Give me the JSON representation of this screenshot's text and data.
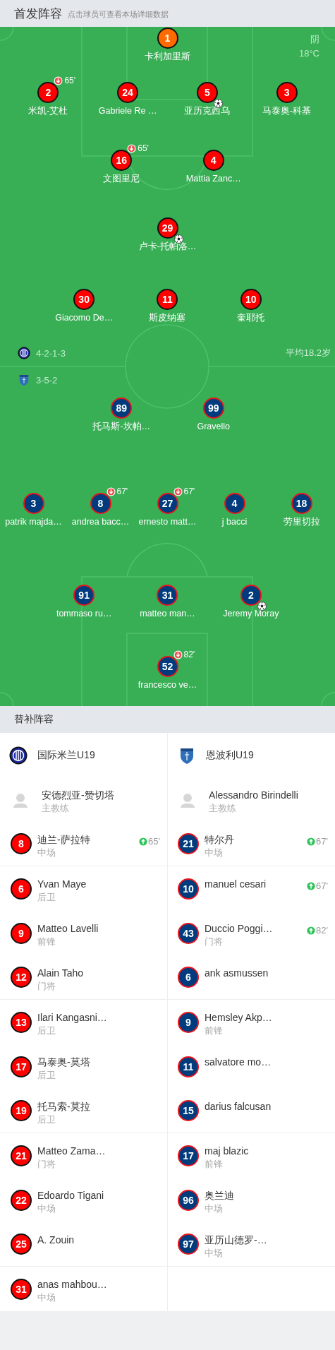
{
  "header": {
    "title": "首发阵容",
    "hint": "点击球员可查看本场详细数据"
  },
  "pitch": {
    "weather": "阴",
    "temperature": "18°C",
    "average_age": "平均18.2岁",
    "teams": [
      {
        "formation": "4-2-1-3",
        "lines": [
          {
            "players": [
              {
                "number": "1",
                "name": "卡利加里斯",
                "color": "#ff6a00",
                "goal": false
              }
            ]
          },
          {
            "players": [
              {
                "number": "2",
                "name": "米凯-艾杜",
                "color": "#ff0000",
                "goal": false,
                "sub_out": "65'"
              },
              {
                "number": "24",
                "name": "Gabriele Re …",
                "color": "#ff0000",
                "goal": false
              },
              {
                "number": "5",
                "name": "亚历克西乌",
                "color": "#ff0000",
                "goal": true
              },
              {
                "number": "3",
                "name": "马泰奥-科基",
                "color": "#ff0000",
                "goal": false
              }
            ]
          },
          {
            "players": [
              {
                "number": "16",
                "name": "文图里尼",
                "color": "#ff0000",
                "goal": false,
                "sub_out": "65'"
              },
              {
                "number": "4",
                "name": "Mattia Zanc…",
                "color": "#ff0000",
                "goal": false
              }
            ]
          },
          {
            "players": [
              {
                "number": "29",
                "name": "卢卡-托帕洛…",
                "color": "#ff0000",
                "goal": true
              }
            ]
          },
          {
            "players": [
              {
                "number": "30",
                "name": "Giacomo De…",
                "color": "#ff0000",
                "goal": false
              },
              {
                "number": "11",
                "name": "斯皮纳塞",
                "color": "#ff0000",
                "goal": false
              },
              {
                "number": "10",
                "name": "奎耶托",
                "color": "#ff0000",
                "goal": false
              }
            ]
          }
        ]
      },
      {
        "formation": "3-5-2",
        "lines": [
          {
            "players": [
              {
                "number": "89",
                "name": "托马斯-坎帕…",
                "color": "#003b7d",
                "goal": false
              },
              {
                "number": "99",
                "name": "Gravello",
                "color": "#003b7d",
                "goal": false
              }
            ]
          },
          {
            "players": [
              {
                "number": "3",
                "name": "patrik majda…",
                "color": "#003b7d",
                "goal": false
              },
              {
                "number": "8",
                "name": "andrea bacc…",
                "color": "#003b7d",
                "goal": false,
                "sub_out": "67'"
              },
              {
                "number": "27",
                "name": "ernesto matt…",
                "color": "#003b7d",
                "goal": false,
                "sub_out": "67'"
              },
              {
                "number": "4",
                "name": "j bacci",
                "color": "#003b7d",
                "goal": false
              },
              {
                "number": "18",
                "name": "劳里切拉",
                "color": "#003b7d",
                "goal": false
              }
            ]
          },
          {
            "players": [
              {
                "number": "91",
                "name": "tommaso ru…",
                "color": "#003b7d",
                "goal": false
              },
              {
                "number": "31",
                "name": "matteo man…",
                "color": "#003b7d",
                "goal": false
              },
              {
                "number": "2",
                "name": "Jeremy Moray",
                "color": "#003b7d",
                "goal": true
              }
            ]
          },
          {
            "players": [
              {
                "number": "52",
                "name": "francesco ve…",
                "color": "#003b7d",
                "goal": false,
                "sub_out": "82'"
              }
            ]
          }
        ]
      }
    ]
  },
  "subs": {
    "title": "替补阵容",
    "teams": [
      {
        "name": "国际米兰U19",
        "coach": {
          "name": "安德烈亚-赞切塔",
          "role": "主教练"
        },
        "players": [
          {
            "number": "8",
            "name": "迪兰-萨拉特",
            "position": "中场",
            "sub_in": "65'"
          },
          {
            "number": "6",
            "name": "Yvan Maye",
            "position": "后卫"
          },
          {
            "number": "9",
            "name": "Matteo Lavelli",
            "position": "前锋"
          },
          {
            "number": "12",
            "name": "Alain Taho",
            "position": "门将"
          },
          {
            "number": "13",
            "name": "Ilari Kangasni…",
            "position": "后卫"
          },
          {
            "number": "17",
            "name": "马泰奥-莫塔",
            "position": "后卫"
          },
          {
            "number": "19",
            "name": "托马索-莫拉",
            "position": "后卫"
          },
          {
            "number": "21",
            "name": "Matteo Zama…",
            "position": "门将"
          },
          {
            "number": "22",
            "name": "Edoardo Tigani",
            "position": "中场"
          },
          {
            "number": "25",
            "name": "A. Zouin"
          },
          {
            "number": "31",
            "name": "anas mahbou…",
            "position": "中场"
          }
        ]
      },
      {
        "name": "恩波利U19",
        "coach": {
          "name": "Alessandro Birindelli",
          "role": "主教练"
        },
        "players": [
          {
            "number": "21",
            "name": "特尔丹",
            "position": "中场",
            "sub_in": "67'"
          },
          {
            "number": "10",
            "name": "manuel cesari",
            "sub_in": "67'"
          },
          {
            "number": "43",
            "name": "Duccio Poggi…",
            "position": "门将",
            "sub_in": "82'"
          },
          {
            "number": "6",
            "name": "ank asmussen"
          },
          {
            "number": "9",
            "name": "Hemsley Akp…",
            "position": "前锋"
          },
          {
            "number": "11",
            "name": "salvatore mo…"
          },
          {
            "number": "15",
            "name": "darius falcusan"
          },
          {
            "number": "17",
            "name": "maj blazic",
            "position": "前锋"
          },
          {
            "number": "96",
            "name": "奥兰迪",
            "position": "中场"
          },
          {
            "number": "97",
            "name": "亚历山德罗-…",
            "position": "中场"
          }
        ]
      }
    ]
  }
}
